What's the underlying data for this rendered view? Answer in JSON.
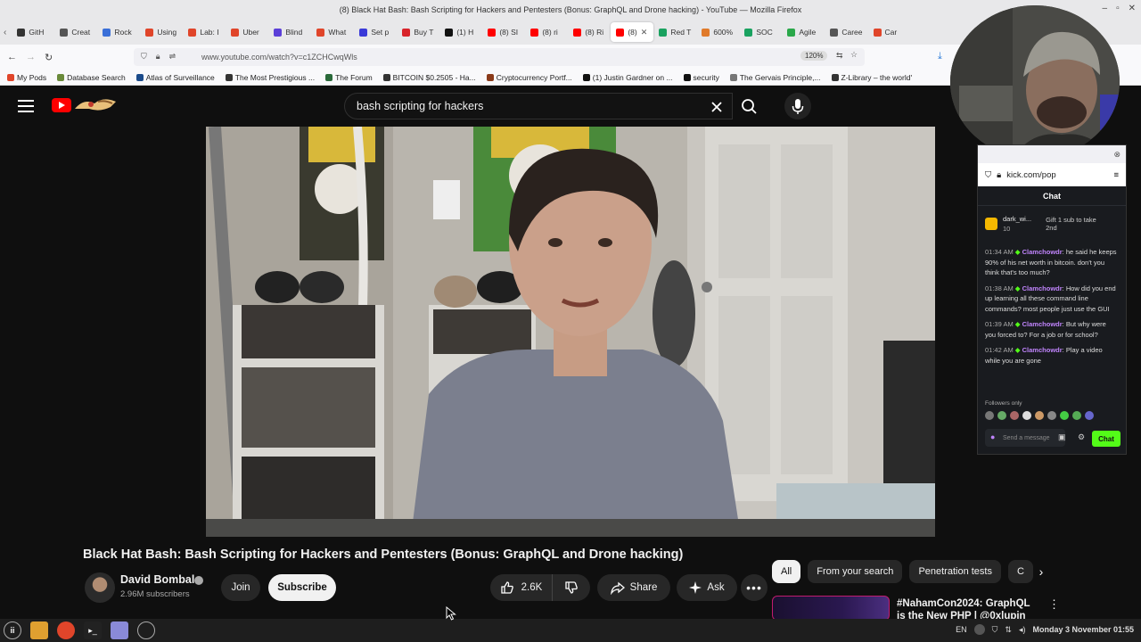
{
  "window": {
    "title": "(8) Black Hat Bash: Bash Scripting for Hackers and Pentesters (Bonus: GraphQL and Drone hacking) - YouTube — Mozilla Firefox"
  },
  "tabs": [
    {
      "label": "GitH",
      "color": "#333333"
    },
    {
      "label": "Creat",
      "color": "#555555"
    },
    {
      "label": "Rock",
      "color": "#3a6fd8"
    },
    {
      "label": "Using",
      "color": "#e0452a"
    },
    {
      "label": "Lab: I",
      "color": "#e0452a"
    },
    {
      "label": "Uber",
      "color": "#e0452a"
    },
    {
      "label": "Blind",
      "color": "#5b3fd8"
    },
    {
      "label": "What",
      "color": "#e0452a"
    },
    {
      "label": "Set p",
      "color": "#3a3ad8"
    },
    {
      "label": "Buy T",
      "color": "#d8232a"
    },
    {
      "label": "(1) H",
      "color": "#111111"
    },
    {
      "label": "(8) SI",
      "color": "#ff0000"
    },
    {
      "label": "(8) ri",
      "color": "#ff0000"
    },
    {
      "label": "(8) Ri",
      "color": "#ff0000"
    },
    {
      "label": "(8)",
      "color": "#ff0000",
      "active": true
    },
    {
      "label": "Red T",
      "color": "#1aa260"
    },
    {
      "label": "600%",
      "color": "#e07a2a"
    },
    {
      "label": "SOC",
      "color": "#1aa260"
    },
    {
      "label": "Agile",
      "color": "#2aa84a"
    },
    {
      "label": "Caree",
      "color": "#555555"
    },
    {
      "label": "Car",
      "color": "#e0452a"
    }
  ],
  "nav": {
    "url": "www.youtube.com/watch?v=c1ZCHCwqWls",
    "zoom": "120%"
  },
  "bookmarks": [
    {
      "label": "My Pods",
      "color": "#e0452a"
    },
    {
      "label": "Database Search",
      "color": "#6a8a3a"
    },
    {
      "label": "Atlas of Surveillance",
      "color": "#1a4a8a"
    },
    {
      "label": "The Most Prestigious ...",
      "color": "#333333"
    },
    {
      "label": "The Forum",
      "color": "#2a6a3a"
    },
    {
      "label": "BITCOIN $0.2505 - Ha...",
      "color": "#333333"
    },
    {
      "label": "Cryptocurrency Portf...",
      "color": "#8a3a1a"
    },
    {
      "label": "(1) Justin Gardner on ...",
      "color": "#111111"
    },
    {
      "label": "security",
      "color": "#111111"
    },
    {
      "label": "The Gervais Principle,...",
      "color": "#777777"
    },
    {
      "label": "Z-Library – the world'",
      "color": "#333333"
    }
  ],
  "youtube": {
    "search_value": "bash scripting for hackers",
    "video_title": "Black Hat Bash: Bash Scripting for Hackers and Pentesters (Bonus: GraphQL and Drone hacking)",
    "channel_name": "David Bombal",
    "subscribers": "2.96M subscribers",
    "join_label": "Join",
    "subscribe_label": "Subscribe",
    "likes": "2.6K",
    "share_label": "Share",
    "ask_label": "Ask",
    "chips": [
      "All",
      "From your search",
      "Penetration tests",
      "C"
    ],
    "related_title": "#NahamCon2024: GraphQL is the New PHP | @0xlupin"
  },
  "kick": {
    "url": "kick.com/pop",
    "header": "Chat",
    "gifter_name": "dark_wi...",
    "gifter_count": "10",
    "gift_text": "Gift 1 sub to take 2nd",
    "messages": [
      {
        "time": "01:34 AM",
        "user": "Clamchowdr",
        "text": "he said he keeps 90% of his net worth in bitcoin. don't you think that's too much?"
      },
      {
        "time": "01:38 AM",
        "user": "Clamchowdr",
        "text": "How did you end up learning all these command line commands? most people just use the GUI"
      },
      {
        "time": "01:39 AM",
        "user": "Clamchowdr",
        "text": "But why were you forced to? For a job or for school?"
      },
      {
        "time": "01:42 AM",
        "user": "Clamchowdr",
        "text": "Play a video while you are gone"
      }
    ],
    "followers_only": "Followers only",
    "input_placeholder": "Send a message",
    "chat_button": "Chat"
  },
  "taskbar": {
    "lang": "EN",
    "clock": "Monday  3 November 01:55"
  },
  "colors": {
    "yt_bg": "#0f0f0f",
    "yt_red": "#ff0000",
    "kick_green": "#53fc18",
    "kick_user": "#c084fc"
  }
}
